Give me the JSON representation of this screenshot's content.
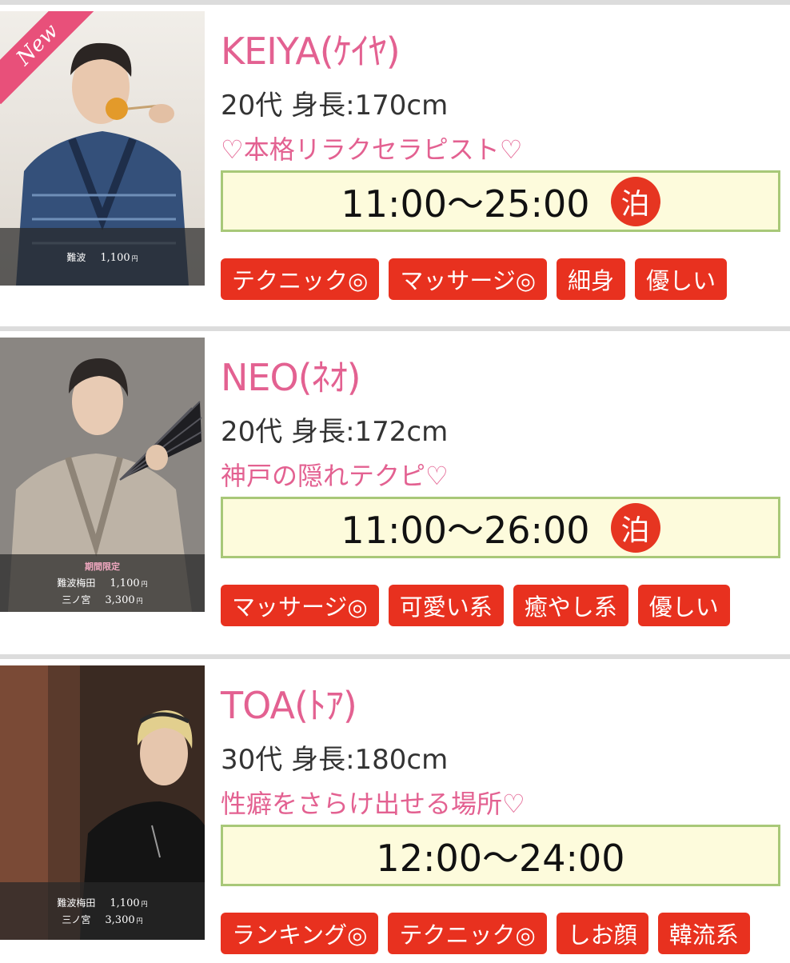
{
  "cards": [
    {
      "name": "KEIYA(ｹｲﾔ)",
      "meta": "20代 身長:170cm",
      "catch": "♡本格リラクセラピスト♡",
      "hours": "11:00〜25:00",
      "stay_badge": "泊",
      "badge_new": "New",
      "photo_caption": {
        "rows": [
          {
            "area": "難波",
            "price": "1,100",
            "yen": "円"
          }
        ]
      },
      "tags": [
        "テクニック◎",
        "マッサージ◎",
        "細身",
        "優しい"
      ]
    },
    {
      "name": "NEO(ﾈｵ)",
      "meta": "20代 身長:172cm",
      "catch": "神戸の隠れテクピ♡",
      "hours": "11:00〜26:00",
      "stay_badge": "泊",
      "photo_caption": {
        "label": "期間限定",
        "rows": [
          {
            "area": "難波梅田",
            "price": "1,100",
            "yen": "円"
          },
          {
            "area": "三ノ宮",
            "price": "3,300",
            "yen": "円"
          }
        ]
      },
      "tags": [
        "マッサージ◎",
        "可愛い系",
        "癒やし系",
        "優しい"
      ]
    },
    {
      "name": "TOA(ﾄｱ)",
      "meta": "30代 身長:180cm",
      "catch": "性癖をさらけ出せる場所♡",
      "hours": "12:00〜24:00",
      "photo_caption": {
        "rows": [
          {
            "area": "難波梅田",
            "price": "1,100",
            "yen": "円"
          },
          {
            "area": "三ノ宮",
            "price": "3,300",
            "yen": "円"
          }
        ]
      },
      "tags": [
        "ランキング◎",
        "テクニック◎",
        "しお顔",
        "韓流系"
      ]
    }
  ],
  "colors": {
    "accent_pink": "#e36191",
    "tag_red": "#e8311f",
    "hours_border": "#a8c878",
    "hours_bg": "#fdfbdc"
  }
}
